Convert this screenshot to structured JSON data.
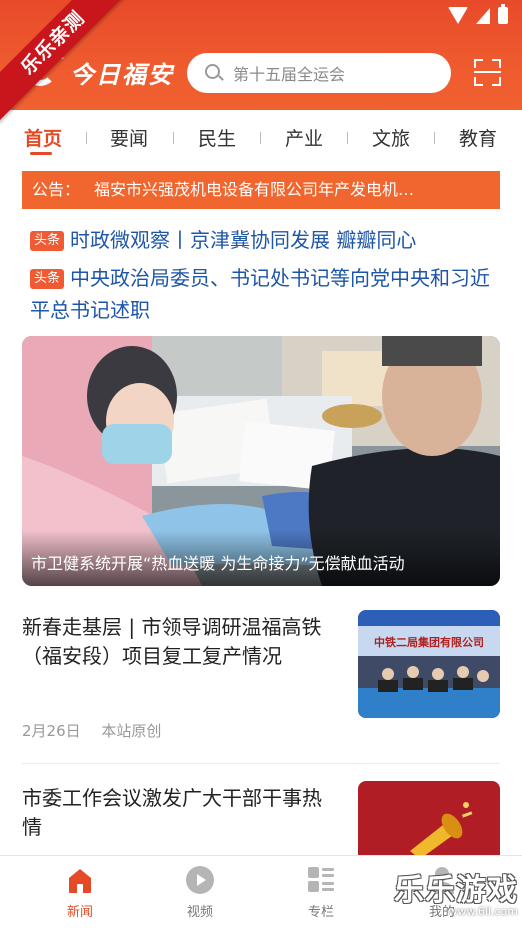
{
  "watermark_ribbon": "乐乐亲测",
  "app": {
    "logo_text": "今日福安"
  },
  "search": {
    "placeholder": "第十五届全运会"
  },
  "tabs": [
    {
      "label": "首页",
      "active": true
    },
    {
      "label": "要闻"
    },
    {
      "label": "民生"
    },
    {
      "label": "产业"
    },
    {
      "label": "文旅"
    },
    {
      "label": "教育"
    }
  ],
  "notice": {
    "label": "公告：",
    "text": "福安市兴强茂机电设备有限公司年产发电机…"
  },
  "headlines": [
    {
      "tag": "头条",
      "text": "时政微观察丨京津冀协同发展 瓣瓣同心"
    },
    {
      "tag": "头条",
      "text": "中央政治局委员、书记处书记等向党中央和习近平总书记述职"
    }
  ],
  "feature": {
    "caption": "市卫健系统开展“热血送暖 为生命接力”无偿献血活动"
  },
  "articles": [
    {
      "title": "新春走基层 | 市领导调研温福高铁（福安段）项目复工复产情况",
      "date": "2月26日",
      "source": "本站原创",
      "thumb_banner": "中铁二局集团有限公司"
    },
    {
      "title": "市委工作会议激发广大干部干事热情"
    }
  ],
  "bottom_nav": [
    {
      "label": "新闻",
      "icon": "home-icon",
      "active": true
    },
    {
      "label": "视频",
      "icon": "play-icon"
    },
    {
      "label": "专栏",
      "icon": "columns-icon"
    },
    {
      "label": "我的",
      "icon": "user-icon"
    }
  ],
  "watermark": {
    "text": "乐乐游戏",
    "url": "www.6ll.com"
  },
  "colors": {
    "brand": "#ef5b2f",
    "active_tab": "#e54a26",
    "headline_link": "#1d56a8"
  }
}
